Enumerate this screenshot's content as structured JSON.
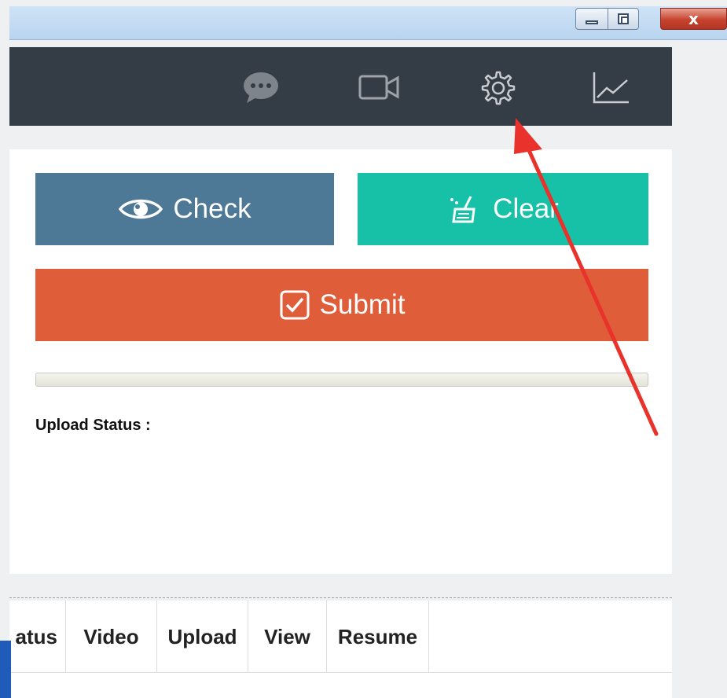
{
  "window": {
    "controls": {
      "close_label": "x"
    }
  },
  "toolbar": {
    "icons": [
      "chat-icon",
      "video-icon",
      "gear-icon",
      "line-chart-icon"
    ]
  },
  "actions": {
    "check_label": "Check",
    "clear_label": "Clear",
    "submit_label": "Submit"
  },
  "upload": {
    "status_label": "Upload Status :",
    "progress_fraction": 0
  },
  "table": {
    "columns": [
      "atus",
      "Video",
      "Upload",
      "View",
      "Resume"
    ]
  },
  "colors": {
    "toolbar_bg": "#343c46",
    "check": "#4d7896",
    "clear": "#17c1a7",
    "submit": "#e05d3a",
    "annotation_arrow": "#e8322b"
  }
}
